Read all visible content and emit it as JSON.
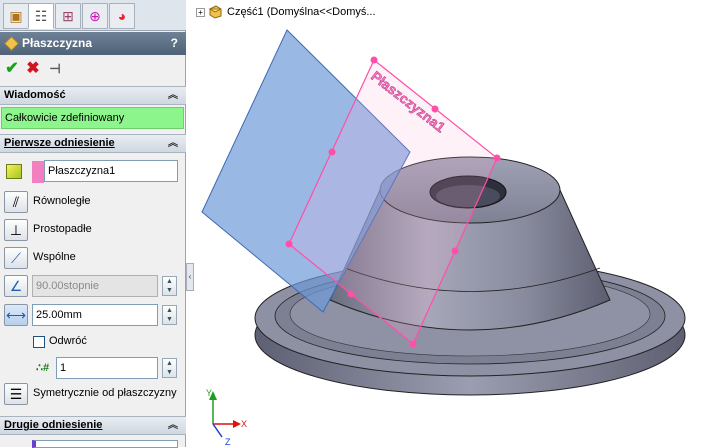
{
  "tabs": [
    {
      "name": "feature-manager",
      "icon": "feature-tree-icon"
    },
    {
      "name": "property-manager",
      "icon": "property-manager-icon"
    },
    {
      "name": "configuration-manager",
      "icon": "configuration-icon"
    },
    {
      "name": "dimxpert-manager",
      "icon": "target-icon"
    },
    {
      "name": "display-manager",
      "icon": "color-wheel-icon"
    }
  ],
  "pm": {
    "title": "Płaszczyzna",
    "help": "?"
  },
  "actions": {
    "ok": "✔",
    "cancel": "✖",
    "pin": "⊣"
  },
  "message": {
    "header": "Wiadomość",
    "text": "Całkowicie zdefiniowany"
  },
  "first_ref": {
    "header": "Pierwsze odniesienie",
    "selection": "Płaszczyzna1",
    "parallel": "Równoległe",
    "perpendicular": "Prostopadłe",
    "coincident": "Wspólne",
    "angle_value": "90.00stopnie",
    "distance_value": "25.00mm",
    "flip": "Odwróć",
    "count_value": "1",
    "symmetric": "Symetrycznie od płaszczyzny"
  },
  "second_ref": {
    "header": "Drugie odniesienie"
  },
  "tree": {
    "expand": "+",
    "part_label": "Część1  (Domyślna<<Domyś..."
  },
  "viewport": {
    "plane_label": "Płaszczyzna1",
    "axes": {
      "x": "X",
      "y": "Y",
      "z": "Z"
    }
  },
  "colors": {
    "accent": "#4f6278",
    "message_ok": "#8cf58c",
    "preview_plane": "#ff4fa8",
    "ref_plane": "#6d9ad8",
    "part_body": "#8a8a9c"
  }
}
